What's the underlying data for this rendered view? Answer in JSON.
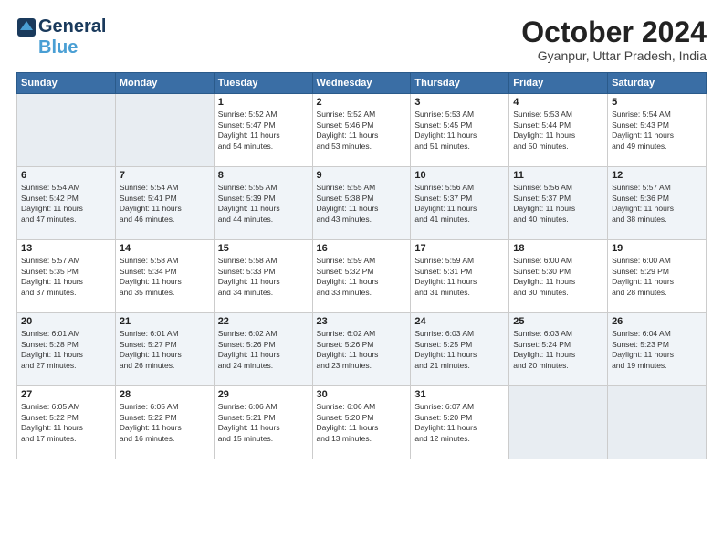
{
  "logo": {
    "line1": "General",
    "line2": "Blue"
  },
  "title": "October 2024",
  "location": "Gyanpur, Uttar Pradesh, India",
  "days_header": [
    "Sunday",
    "Monday",
    "Tuesday",
    "Wednesday",
    "Thursday",
    "Friday",
    "Saturday"
  ],
  "weeks": [
    [
      {
        "day": "",
        "content": ""
      },
      {
        "day": "",
        "content": ""
      },
      {
        "day": "1",
        "content": "Sunrise: 5:52 AM\nSunset: 5:47 PM\nDaylight: 11 hours\nand 54 minutes."
      },
      {
        "day": "2",
        "content": "Sunrise: 5:52 AM\nSunset: 5:46 PM\nDaylight: 11 hours\nand 53 minutes."
      },
      {
        "day": "3",
        "content": "Sunrise: 5:53 AM\nSunset: 5:45 PM\nDaylight: 11 hours\nand 51 minutes."
      },
      {
        "day": "4",
        "content": "Sunrise: 5:53 AM\nSunset: 5:44 PM\nDaylight: 11 hours\nand 50 minutes."
      },
      {
        "day": "5",
        "content": "Sunrise: 5:54 AM\nSunset: 5:43 PM\nDaylight: 11 hours\nand 49 minutes."
      }
    ],
    [
      {
        "day": "6",
        "content": "Sunrise: 5:54 AM\nSunset: 5:42 PM\nDaylight: 11 hours\nand 47 minutes."
      },
      {
        "day": "7",
        "content": "Sunrise: 5:54 AM\nSunset: 5:41 PM\nDaylight: 11 hours\nand 46 minutes."
      },
      {
        "day": "8",
        "content": "Sunrise: 5:55 AM\nSunset: 5:39 PM\nDaylight: 11 hours\nand 44 minutes."
      },
      {
        "day": "9",
        "content": "Sunrise: 5:55 AM\nSunset: 5:38 PM\nDaylight: 11 hours\nand 43 minutes."
      },
      {
        "day": "10",
        "content": "Sunrise: 5:56 AM\nSunset: 5:37 PM\nDaylight: 11 hours\nand 41 minutes."
      },
      {
        "day": "11",
        "content": "Sunrise: 5:56 AM\nSunset: 5:37 PM\nDaylight: 11 hours\nand 40 minutes."
      },
      {
        "day": "12",
        "content": "Sunrise: 5:57 AM\nSunset: 5:36 PM\nDaylight: 11 hours\nand 38 minutes."
      }
    ],
    [
      {
        "day": "13",
        "content": "Sunrise: 5:57 AM\nSunset: 5:35 PM\nDaylight: 11 hours\nand 37 minutes."
      },
      {
        "day": "14",
        "content": "Sunrise: 5:58 AM\nSunset: 5:34 PM\nDaylight: 11 hours\nand 35 minutes."
      },
      {
        "day": "15",
        "content": "Sunrise: 5:58 AM\nSunset: 5:33 PM\nDaylight: 11 hours\nand 34 minutes."
      },
      {
        "day": "16",
        "content": "Sunrise: 5:59 AM\nSunset: 5:32 PM\nDaylight: 11 hours\nand 33 minutes."
      },
      {
        "day": "17",
        "content": "Sunrise: 5:59 AM\nSunset: 5:31 PM\nDaylight: 11 hours\nand 31 minutes."
      },
      {
        "day": "18",
        "content": "Sunrise: 6:00 AM\nSunset: 5:30 PM\nDaylight: 11 hours\nand 30 minutes."
      },
      {
        "day": "19",
        "content": "Sunrise: 6:00 AM\nSunset: 5:29 PM\nDaylight: 11 hours\nand 28 minutes."
      }
    ],
    [
      {
        "day": "20",
        "content": "Sunrise: 6:01 AM\nSunset: 5:28 PM\nDaylight: 11 hours\nand 27 minutes."
      },
      {
        "day": "21",
        "content": "Sunrise: 6:01 AM\nSunset: 5:27 PM\nDaylight: 11 hours\nand 26 minutes."
      },
      {
        "day": "22",
        "content": "Sunrise: 6:02 AM\nSunset: 5:26 PM\nDaylight: 11 hours\nand 24 minutes."
      },
      {
        "day": "23",
        "content": "Sunrise: 6:02 AM\nSunset: 5:26 PM\nDaylight: 11 hours\nand 23 minutes."
      },
      {
        "day": "24",
        "content": "Sunrise: 6:03 AM\nSunset: 5:25 PM\nDaylight: 11 hours\nand 21 minutes."
      },
      {
        "day": "25",
        "content": "Sunrise: 6:03 AM\nSunset: 5:24 PM\nDaylight: 11 hours\nand 20 minutes."
      },
      {
        "day": "26",
        "content": "Sunrise: 6:04 AM\nSunset: 5:23 PM\nDaylight: 11 hours\nand 19 minutes."
      }
    ],
    [
      {
        "day": "27",
        "content": "Sunrise: 6:05 AM\nSunset: 5:22 PM\nDaylight: 11 hours\nand 17 minutes."
      },
      {
        "day": "28",
        "content": "Sunrise: 6:05 AM\nSunset: 5:22 PM\nDaylight: 11 hours\nand 16 minutes."
      },
      {
        "day": "29",
        "content": "Sunrise: 6:06 AM\nSunset: 5:21 PM\nDaylight: 11 hours\nand 15 minutes."
      },
      {
        "day": "30",
        "content": "Sunrise: 6:06 AM\nSunset: 5:20 PM\nDaylight: 11 hours\nand 13 minutes."
      },
      {
        "day": "31",
        "content": "Sunrise: 6:07 AM\nSunset: 5:20 PM\nDaylight: 11 hours\nand 12 minutes."
      },
      {
        "day": "",
        "content": ""
      },
      {
        "day": "",
        "content": ""
      }
    ]
  ]
}
